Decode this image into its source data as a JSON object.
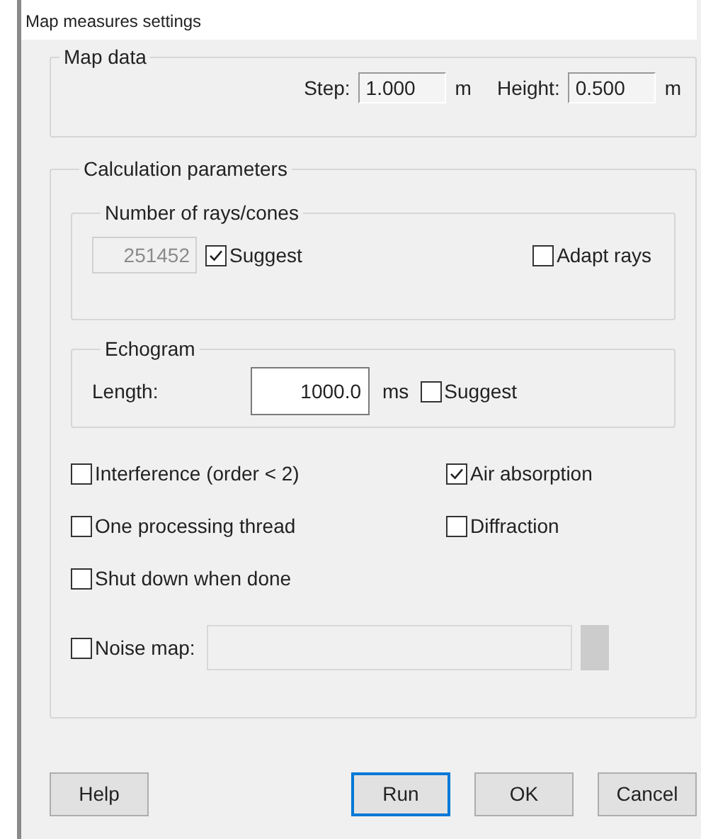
{
  "window": {
    "title": "Map measures settings"
  },
  "map_data": {
    "title": "Map data",
    "fields": [
      {
        "label": "Step:",
        "value": "1.000",
        "unit": "m"
      },
      {
        "label": "Height:",
        "value": "0.500",
        "unit": "m"
      }
    ]
  },
  "calculation": {
    "title": "Calculation parameters",
    "rays": {
      "title": "Number of rays/cones",
      "count": {
        "value": "251452",
        "disabled": true
      },
      "checkboxes": [
        {
          "label": "Suggest",
          "checked": true
        },
        {
          "label": "Adapt rays",
          "checked": false
        }
      ]
    },
    "echogram": {
      "title": "Echogram",
      "label": "Length:",
      "value": "1000.0",
      "unit": "ms",
      "suggest": {
        "label": "Suggest",
        "checked": false
      }
    },
    "options": [
      {
        "label": "Interference (order  < 2)",
        "checked": false
      },
      {
        "label": "Air absorption",
        "checked": true
      },
      {
        "label": "One processing thread",
        "checked": false
      },
      {
        "label": "Diffraction",
        "checked": false
      },
      {
        "label": "Shut down when done",
        "checked": false
      }
    ],
    "noise_map": {
      "label": "Noise map:",
      "checked": false,
      "disabled": true
    }
  },
  "buttons": [
    {
      "label": "Help",
      "default": false
    },
    {
      "label": "Run",
      "default": true
    },
    {
      "label": "OK",
      "default": false
    },
    {
      "label": "Cancel",
      "default": false
    }
  ]
}
